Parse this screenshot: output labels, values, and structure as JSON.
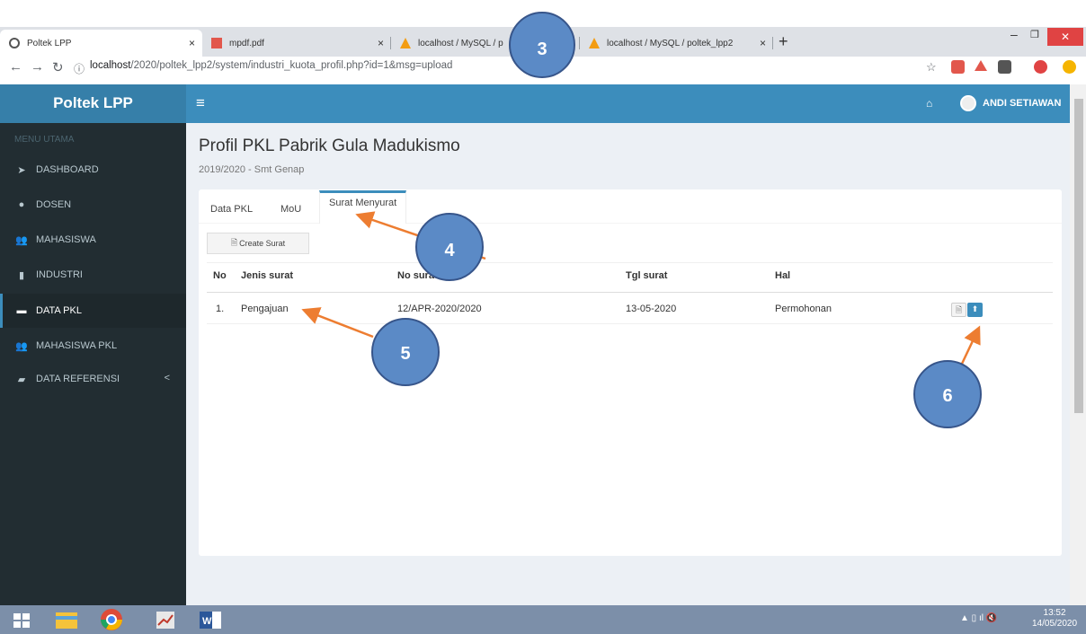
{
  "browser": {
    "tabs": [
      {
        "title": "Poltek LPP",
        "close": "×"
      },
      {
        "title": "mpdf.pdf",
        "close": "×"
      },
      {
        "title": "localhost / MySQL / p",
        "close": "×"
      },
      {
        "title": "localhost / MySQL / poltek_lpp2",
        "close": "×"
      }
    ],
    "new_tab": "+",
    "url_prefix": "localhost",
    "url_rest": "/2020/poltek_lpp2/system/industri_kuota_profil.php?id=1&msg=upload"
  },
  "app": {
    "brand": "Poltek LPP",
    "menu_toggle": "≡",
    "user_name": "ANDI SETIAWAN",
    "home_icon": "🏠"
  },
  "sidebar": {
    "header": "MENU UTAMA",
    "items": [
      {
        "label": "DASHBOARD",
        "icon": "➤"
      },
      {
        "label": "DOSEN",
        "icon": "●"
      },
      {
        "label": "MAHASISWA",
        "icon": "👥"
      },
      {
        "label": "INDUSTRI",
        "icon": "▮"
      },
      {
        "label": "DATA PKL",
        "icon": "▬"
      },
      {
        "label": "MAHASISWA PKL",
        "icon": "👥"
      },
      {
        "label": "DATA REFERENSI",
        "icon": "▰",
        "chevron": "<"
      }
    ]
  },
  "page": {
    "title": "Profil PKL Pabrik Gula Madukismo",
    "subtitle": "2019/2020 - Smt Genap",
    "tabs": [
      "Data PKL",
      "MoU",
      "Surat Menyurat"
    ],
    "create_button": "Create Surat",
    "table": {
      "headers": [
        "No",
        "Jenis surat",
        "No surat",
        "Tgl surat",
        "Hal"
      ],
      "rows": [
        {
          "no": "1.",
          "jenis": "Pengajuan",
          "no_surat": "12/APR-2020/2020",
          "tgl": "13-05-2020",
          "hal": "Permohonan"
        }
      ]
    }
  },
  "callouts": [
    "3",
    "4",
    "5",
    "6"
  ],
  "taskbar": {
    "time": "13:52",
    "date": "14/05/2020"
  }
}
